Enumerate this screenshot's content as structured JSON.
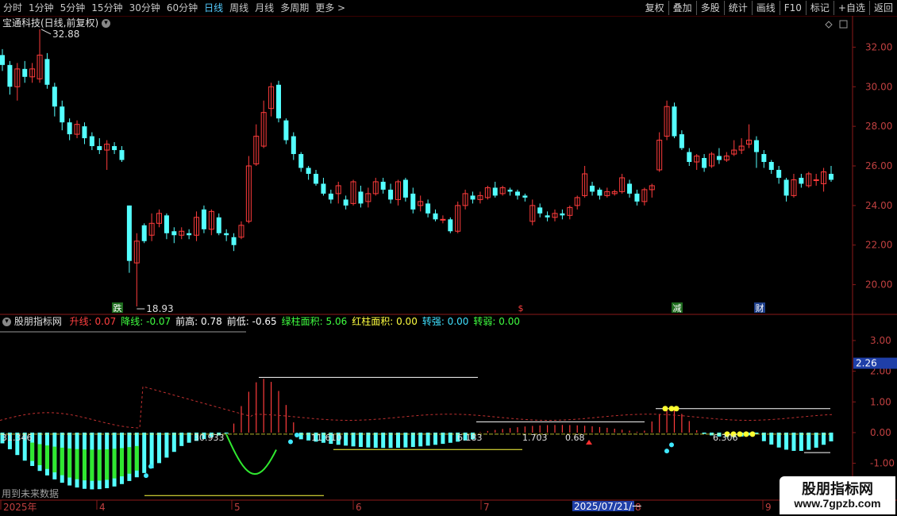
{
  "toolbar": {
    "periods": [
      "分时",
      "1分钟",
      "5分钟",
      "15分钟",
      "30分钟",
      "60分钟",
      "日线",
      "周线",
      "月线",
      "多周期",
      "更多"
    ],
    "more_arrow": ">",
    "selected_period": "日线",
    "right_buttons": [
      "复权",
      "叠加",
      "多股",
      "统计",
      "画线",
      "F10",
      "标记",
      "+自选",
      "返回"
    ]
  },
  "stock": {
    "title": "宝通科技(日线,前复权)",
    "high_label": "32.88",
    "low_label": "18.93"
  },
  "price_axis": [
    "32.00",
    "30.00",
    "28.00",
    "26.00",
    "24.00",
    "22.00",
    "20.00"
  ],
  "event_markers": [
    {
      "text": "跌",
      "color": "#ffffff",
      "bg": "#1e6b1e"
    },
    {
      "text": "$",
      "color": "#ff4040",
      "bg": "#000000"
    },
    {
      "text": "减",
      "color": "#ffffff",
      "bg": "#1e6b1e"
    },
    {
      "text": "财",
      "color": "#ffffff",
      "bg": "#1e3f8a"
    }
  ],
  "indicator": {
    "name": "股朋指标网",
    "params": [
      {
        "label": "升线:",
        "value": "0.07",
        "color": "#ff4040"
      },
      {
        "label": "降线:",
        "value": "-0.07",
        "color": "#40ff40"
      },
      {
        "label": "前高:",
        "value": "0.78",
        "color": "#ffffff"
      },
      {
        "label": "前低:",
        "value": "-0.65",
        "color": "#ffffff"
      },
      {
        "label": "绿柱面积:",
        "value": "5.06",
        "color": "#40ff40"
      },
      {
        "label": "红柱面积:",
        "value": "0.00",
        "color": "#ffff40"
      },
      {
        "label": "转强:",
        "value": "0.00",
        "color": "#40e0ff"
      },
      {
        "label": "转弱:",
        "value": "0.00",
        "color": "#40ff40"
      }
    ],
    "axis": [
      "3.00",
      "2.00",
      "1.00",
      "0.00",
      "-1.00"
    ],
    "current_value": "2.26",
    "inline_labels": [
      "31.346",
      "30.933",
      "11.610",
      "6.183",
      "1.703",
      "0.68",
      "6.306"
    ],
    "future_note": "用到未来数据"
  },
  "date_axis": {
    "labels": [
      "2025年",
      "4",
      "5",
      "6",
      "7",
      "8",
      "9"
    ],
    "cursor_date": "2025/07/21/一"
  },
  "watermark": {
    "title": "股朋指标网",
    "url": "www.7gpzb.com"
  },
  "colors": {
    "up": "#ff3c3c",
    "down": "#54ffff",
    "green_bar": "#30e830",
    "frame": "#8b1a1a"
  },
  "chart_data": {
    "type": "candlestick",
    "price_ylim": [
      18.5,
      33.5
    ],
    "candles_approx": [
      [
        31.6,
        31.1,
        31.9,
        30.8
      ],
      [
        31.1,
        30.0,
        31.3,
        29.6
      ],
      [
        30.0,
        30.9,
        31.2,
        29.3
      ],
      [
        30.9,
        30.5,
        31.3,
        30.2
      ],
      [
        30.5,
        30.9,
        31.2,
        30.2
      ],
      [
        30.4,
        31.6,
        32.9,
        30.2
      ],
      [
        31.4,
        30.1,
        31.7,
        29.9
      ],
      [
        30.0,
        29.0,
        30.2,
        28.5
      ],
      [
        29.0,
        28.2,
        29.3,
        27.8
      ],
      [
        28.2,
        27.6,
        28.4,
        27.3
      ],
      [
        27.6,
        28.1,
        28.3,
        27.4
      ],
      [
        28.0,
        27.4,
        28.2,
        27.1
      ],
      [
        27.5,
        27.0,
        27.7,
        26.8
      ],
      [
        27.0,
        26.8,
        27.4,
        26.6
      ],
      [
        26.8,
        27.1,
        27.3,
        25.8
      ],
      [
        27.0,
        26.8,
        27.2,
        26.6
      ],
      [
        26.8,
        26.3,
        27.0,
        26.2
      ],
      [
        24.0,
        21.2,
        24.0,
        20.6
      ],
      [
        21.1,
        22.2,
        22.6,
        18.9
      ],
      [
        23.0,
        22.2,
        23.1,
        22.1
      ],
      [
        22.5,
        23.1,
        23.6,
        22.2
      ],
      [
        23.1,
        23.6,
        23.8,
        22.9
      ],
      [
        23.5,
        22.6,
        23.6,
        22.3
      ],
      [
        22.7,
        22.5,
        22.9,
        22.1
      ],
      [
        22.5,
        22.7,
        22.9,
        22.3
      ],
      [
        22.6,
        22.5,
        22.8,
        22.3
      ],
      [
        22.5,
        23.4,
        23.7,
        22.2
      ],
      [
        23.8,
        22.8,
        24.0,
        22.6
      ],
      [
        22.8,
        23.7,
        23.8,
        22.5
      ],
      [
        23.4,
        22.6,
        23.6,
        22.5
      ],
      [
        22.6,
        22.5,
        22.8,
        22.2
      ],
      [
        22.4,
        22.0,
        22.6,
        21.7
      ],
      [
        22.4,
        23.0,
        23.2,
        22.3
      ],
      [
        23.2,
        26.0,
        26.5,
        23.1
      ],
      [
        26.1,
        27.5,
        28.1,
        26.0
      ],
      [
        27.0,
        28.7,
        29.3,
        26.9
      ],
      [
        28.9,
        30.0,
        30.2,
        28.5
      ],
      [
        30.1,
        28.4,
        30.3,
        28.2
      ],
      [
        28.3,
        27.3,
        28.4,
        27.1
      ],
      [
        27.5,
        26.6,
        27.7,
        26.3
      ],
      [
        26.6,
        25.9,
        26.7,
        25.7
      ],
      [
        25.9,
        25.6,
        26.0,
        25.3
      ],
      [
        25.6,
        25.1,
        25.8,
        25.0
      ],
      [
        25.1,
        24.6,
        25.4,
        24.5
      ],
      [
        24.6,
        24.3,
        24.8,
        24.1
      ],
      [
        24.6,
        25.0,
        25.2,
        24.1
      ],
      [
        24.3,
        24.0,
        24.5,
        23.8
      ],
      [
        24.1,
        25.2,
        25.3,
        24.0
      ],
      [
        24.7,
        24.1,
        25.0,
        23.9
      ],
      [
        24.2,
        24.6,
        24.9,
        23.9
      ],
      [
        24.6,
        25.2,
        25.4,
        24.5
      ],
      [
        25.2,
        24.8,
        25.4,
        24.6
      ],
      [
        24.8,
        24.3,
        25.1,
        24.1
      ],
      [
        24.3,
        25.2,
        25.3,
        24.0
      ],
      [
        25.3,
        24.4,
        25.4,
        24.2
      ],
      [
        24.6,
        23.8,
        24.9,
        23.6
      ],
      [
        24.0,
        24.2,
        24.5,
        23.7
      ],
      [
        24.1,
        23.6,
        24.3,
        23.4
      ],
      [
        23.6,
        23.3,
        23.8,
        23.2
      ],
      [
        23.3,
        23.3,
        23.5,
        23.1
      ],
      [
        23.3,
        22.7,
        23.4,
        22.6
      ],
      [
        22.7,
        24.0,
        24.2,
        22.6
      ],
      [
        24.0,
        24.6,
        24.8,
        23.8
      ],
      [
        24.5,
        24.3,
        24.7,
        24.1
      ],
      [
        24.3,
        24.5,
        24.7,
        24.1
      ],
      [
        24.4,
        24.9,
        25.0,
        24.3
      ],
      [
        24.9,
        24.5,
        25.2,
        24.4
      ],
      [
        24.6,
        24.9,
        25.0,
        24.5
      ],
      [
        24.8,
        24.7,
        24.9,
        24.5
      ],
      [
        24.7,
        24.5,
        24.8,
        24.3
      ],
      [
        24.5,
        24.4,
        24.6,
        24.2
      ],
      [
        23.2,
        24.0,
        24.3,
        23.0
      ],
      [
        23.9,
        23.6,
        24.1,
        23.4
      ],
      [
        23.5,
        23.4,
        23.7,
        23.2
      ],
      [
        23.4,
        23.6,
        23.8,
        23.2
      ],
      [
        23.6,
        23.5,
        23.8,
        23.3
      ],
      [
        23.5,
        23.9,
        24.0,
        23.3
      ],
      [
        24.0,
        24.4,
        24.5,
        23.8
      ],
      [
        24.5,
        25.6,
        26.0,
        24.4
      ],
      [
        25.0,
        24.7,
        25.2,
        24.5
      ],
      [
        24.8,
        24.5,
        24.9,
        24.3
      ],
      [
        24.5,
        24.7,
        24.9,
        24.4
      ],
      [
        24.6,
        24.7,
        24.8,
        24.5
      ],
      [
        24.7,
        25.4,
        25.6,
        24.6
      ],
      [
        25.1,
        24.6,
        25.3,
        24.4
      ],
      [
        24.6,
        24.2,
        24.8,
        24.0
      ],
      [
        24.2,
        24.8,
        24.9,
        24.0
      ],
      [
        24.8,
        25.0,
        25.1,
        24.4
      ],
      [
        25.8,
        27.3,
        27.7,
        25.7
      ],
      [
        27.5,
        29.0,
        29.3,
        27.3
      ],
      [
        29.0,
        27.5,
        29.2,
        27.4
      ],
      [
        27.6,
        26.9,
        27.8,
        26.8
      ],
      [
        26.7,
        26.2,
        26.9,
        26.0
      ],
      [
        26.2,
        26.5,
        26.6,
        25.8
      ],
      [
        26.4,
        25.9,
        26.6,
        25.7
      ],
      [
        26.0,
        26.6,
        26.7,
        25.9
      ],
      [
        26.5,
        26.3,
        26.9,
        26.1
      ],
      [
        26.3,
        26.5,
        26.7,
        26.2
      ],
      [
        26.6,
        26.8,
        27.3,
        26.5
      ],
      [
        26.8,
        27.0,
        27.4,
        26.6
      ],
      [
        27.1,
        27.3,
        28.1,
        26.9
      ],
      [
        27.3,
        26.7,
        27.5,
        25.9
      ],
      [
        26.6,
        26.2,
        26.8,
        25.9
      ],
      [
        26.2,
        25.8,
        26.3,
        25.6
      ],
      [
        25.8,
        25.4,
        26.0,
        25.1
      ],
      [
        25.3,
        24.5,
        25.4,
        24.2
      ],
      [
        24.5,
        25.3,
        25.6,
        24.4
      ],
      [
        25.4,
        25.1,
        25.6,
        24.9
      ],
      [
        25.0,
        25.6,
        25.7,
        24.9
      ],
      [
        25.3,
        25.3,
        25.6,
        25.0
      ],
      [
        25.1,
        25.7,
        25.9,
        24.7
      ],
      [
        25.6,
        25.3,
        26.0,
        25.2
      ]
    ],
    "indicator_ylim": [
      -2.2,
      3.8
    ],
    "levels": {
      "prev_high": 0.78,
      "prev_low": -0.65
    }
  }
}
